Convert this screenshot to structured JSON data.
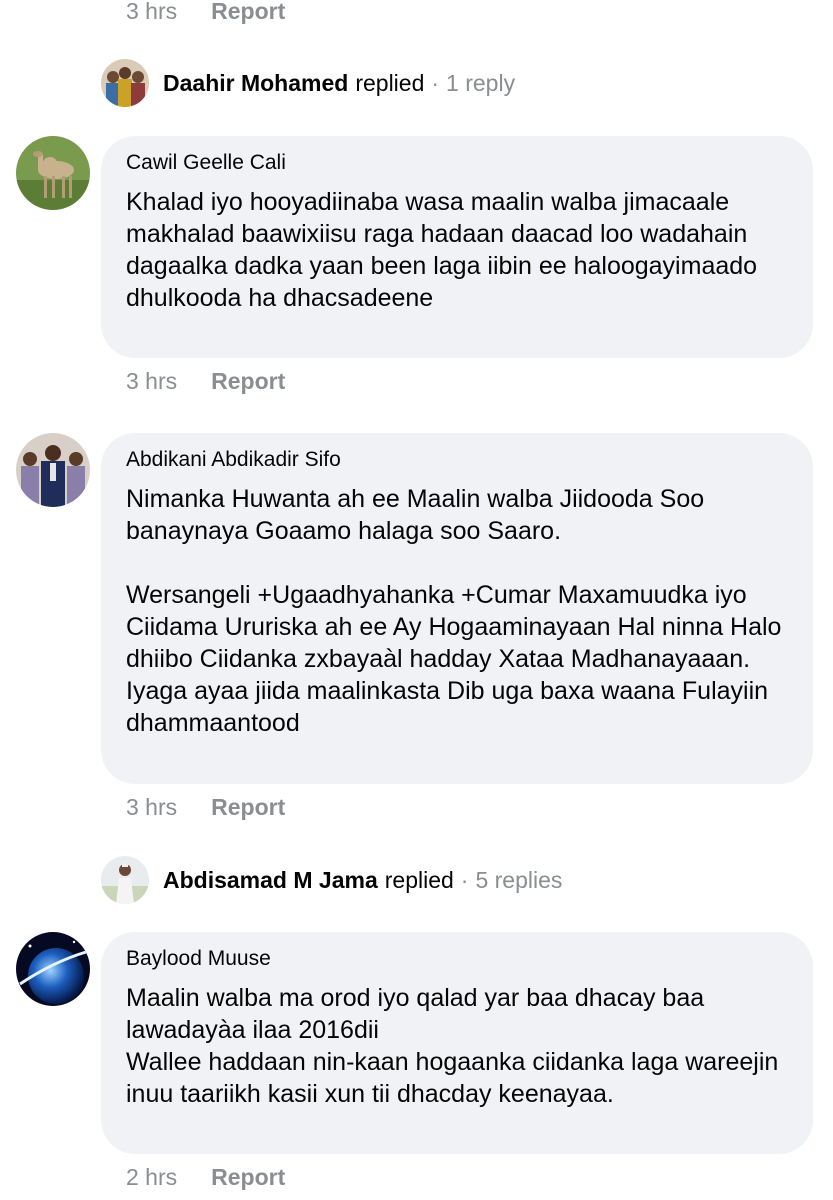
{
  "top_meta": {
    "time": "3 hrs",
    "report": "Report"
  },
  "reply_1": {
    "name": "Daahir Mohamed",
    "verb": "replied",
    "separator": "·",
    "count": "1 reply",
    "avatar_icon": "group-photo-avatar"
  },
  "comments": [
    {
      "author": "Cawil Geelle Cali",
      "avatar_icon": "camel-photo-avatar",
      "text": "Khalad iyo hooyadiinaba wasa maalin walba jimacaale makhalad baawixiisu raga hadaan daacad loo wadahain dagaalka dadka yaan been laga iibin ee haloogayimaado dhulkooda ha dhacsadeene",
      "time": "3 hrs",
      "report": "Report"
    },
    {
      "author": "Abdikani Abdikadir Sifo",
      "avatar_icon": "suited-men-photo-avatar",
      "text": "Nimanka Huwanta ah ee Maalin walba Jiidooda Soo banaynaya Goaamo halaga soo Saaro.\n\nWersangeli +Ugaadhyahanka +Cumar Maxamuudka iyo Ciidama Ururiska ah ee Ay Hogaaminayaan Hal ninna Halo dhiibo Ciidanka zxbayaàl hadday Xataa Madhanayaaan. Iyaga ayaa jiida maalinkasta Dib uga baxa waana Fulayiin dhammaantood",
      "time": "3 hrs",
      "report": "Report"
    }
  ],
  "reply_2": {
    "name": "Abdisamad M Jama",
    "verb": "replied",
    "separator": "·",
    "count": "5 replies",
    "avatar_icon": "person-photo-avatar"
  },
  "last_comment": {
    "author": "Baylood Muuse",
    "avatar_icon": "planet-photo-avatar",
    "text": "Maalin walba ma orod iyo qalad yar baa dhacay baa lawadayàa ilaa 2016dii\nWallee haddaan nin-kaan hogaanka ciidanka laga wareejin inuu taariikh kasii xun tii dhacday keenayaa.",
    "time": "2 hrs",
    "report": "Report"
  },
  "colors": {
    "bubble_bg": "#f0f2f5",
    "meta_text": "#8a8d91",
    "primary_text": "#050505"
  }
}
